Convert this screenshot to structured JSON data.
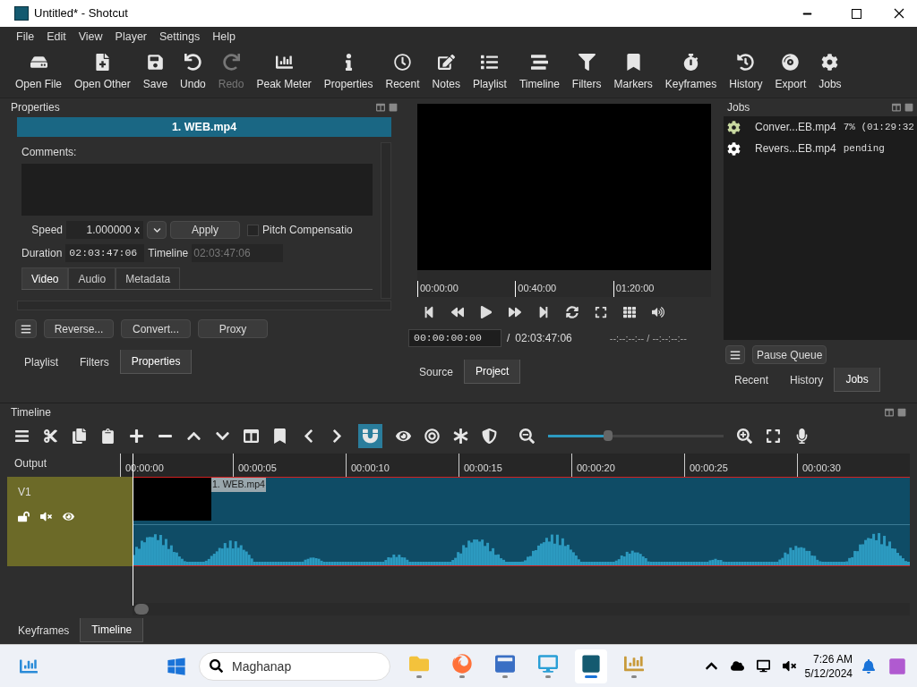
{
  "window": {
    "title": "Untitled* - Shotcut"
  },
  "menu": [
    {
      "label": "File"
    },
    {
      "label": "Edit"
    },
    {
      "label": "View"
    },
    {
      "label": "Player"
    },
    {
      "label": "Settings"
    },
    {
      "label": "Help"
    }
  ],
  "toolbar": [
    {
      "label": "Open File",
      "disabled": false
    },
    {
      "label": "Open Other",
      "disabled": false
    },
    {
      "label": "Save",
      "disabled": false
    },
    {
      "label": "Undo",
      "disabled": false
    },
    {
      "label": "Redo",
      "disabled": true
    },
    {
      "label": "Peak Meter",
      "disabled": false
    },
    {
      "label": "Properties",
      "disabled": false
    },
    {
      "label": "Recent",
      "disabled": false
    },
    {
      "label": "Notes",
      "disabled": false
    },
    {
      "label": "Playlist",
      "disabled": false
    },
    {
      "label": "Timeline",
      "disabled": false
    },
    {
      "label": "Filters",
      "disabled": false
    },
    {
      "label": "Markers",
      "disabled": false
    },
    {
      "label": "Keyframes",
      "disabled": false
    },
    {
      "label": "History",
      "disabled": false
    },
    {
      "label": "Export",
      "disabled": false
    },
    {
      "label": "Jobs",
      "disabled": false
    }
  ],
  "properties": {
    "title": "Properties",
    "clip_name": "1. WEB.mp4",
    "comments_label": "Comments:",
    "speed_label": "Speed",
    "speed_value": "1.000000 x",
    "apply": "Apply",
    "pitch_label": "Pitch Compensatio",
    "pitch_checked": false,
    "duration_label": "Duration",
    "duration_value": "02:03:47:06",
    "timeline_label": "Timeline",
    "timeline_value": "02:03:47:06",
    "tabs": [
      {
        "label": "Video",
        "selected": true
      },
      {
        "label": "Audio",
        "selected": false
      },
      {
        "label": "Metadata",
        "selected": false
      }
    ],
    "buttons": [
      "Reverse...",
      "Convert...",
      "Proxy"
    ],
    "dock_tabs": [
      {
        "label": "Playlist",
        "selected": false
      },
      {
        "label": "Filters",
        "selected": false
      },
      {
        "label": "Properties",
        "selected": true
      }
    ]
  },
  "player": {
    "ruler": [
      "00:00:00",
      "00:40:00",
      "01:20:00"
    ],
    "timecode": "00:00:00:00",
    "separator": "/",
    "duration": "02:03:47:06",
    "in_out": "--:--:--:-- / --:--:--:--",
    "tabs": [
      {
        "label": "Source",
        "selected": false
      },
      {
        "label": "Project",
        "selected": true
      }
    ]
  },
  "jobs": {
    "title": "Jobs",
    "items": [
      {
        "name": "Conver...EB.mp4",
        "status": "7% (01:29:32",
        "running": true
      },
      {
        "name": "Revers...EB.mp4",
        "status": "pending",
        "running": false
      }
    ],
    "pause": "Pause Queue",
    "tabs": [
      {
        "label": "Recent",
        "selected": false
      },
      {
        "label": "History",
        "selected": false
      },
      {
        "label": "Jobs",
        "selected": true
      }
    ]
  },
  "timeline": {
    "title": "Timeline",
    "snapping": true,
    "zoom": {
      "level": 0.34
    },
    "output_label": "Output",
    "ruler": [
      "00:00:00",
      "00:00:05",
      "00:00:10",
      "00:00:15",
      "00:00:20",
      "00:00:25",
      "00:00:30"
    ],
    "track": {
      "name": "V1",
      "clip": "1. WEB.mp4"
    },
    "tabs": [
      {
        "label": "Keyframes",
        "selected": false
      },
      {
        "label": "Timeline",
        "selected": true
      }
    ]
  },
  "taskbar": {
    "search_placeholder": "Maghanap",
    "time": "7:26 AM",
    "date": "5/12/2024",
    "apps": [
      {
        "selected": false
      },
      {
        "selected": false
      },
      {
        "selected": false
      },
      {
        "selected": false
      },
      {
        "selected": true
      },
      {
        "selected": false
      }
    ]
  }
}
